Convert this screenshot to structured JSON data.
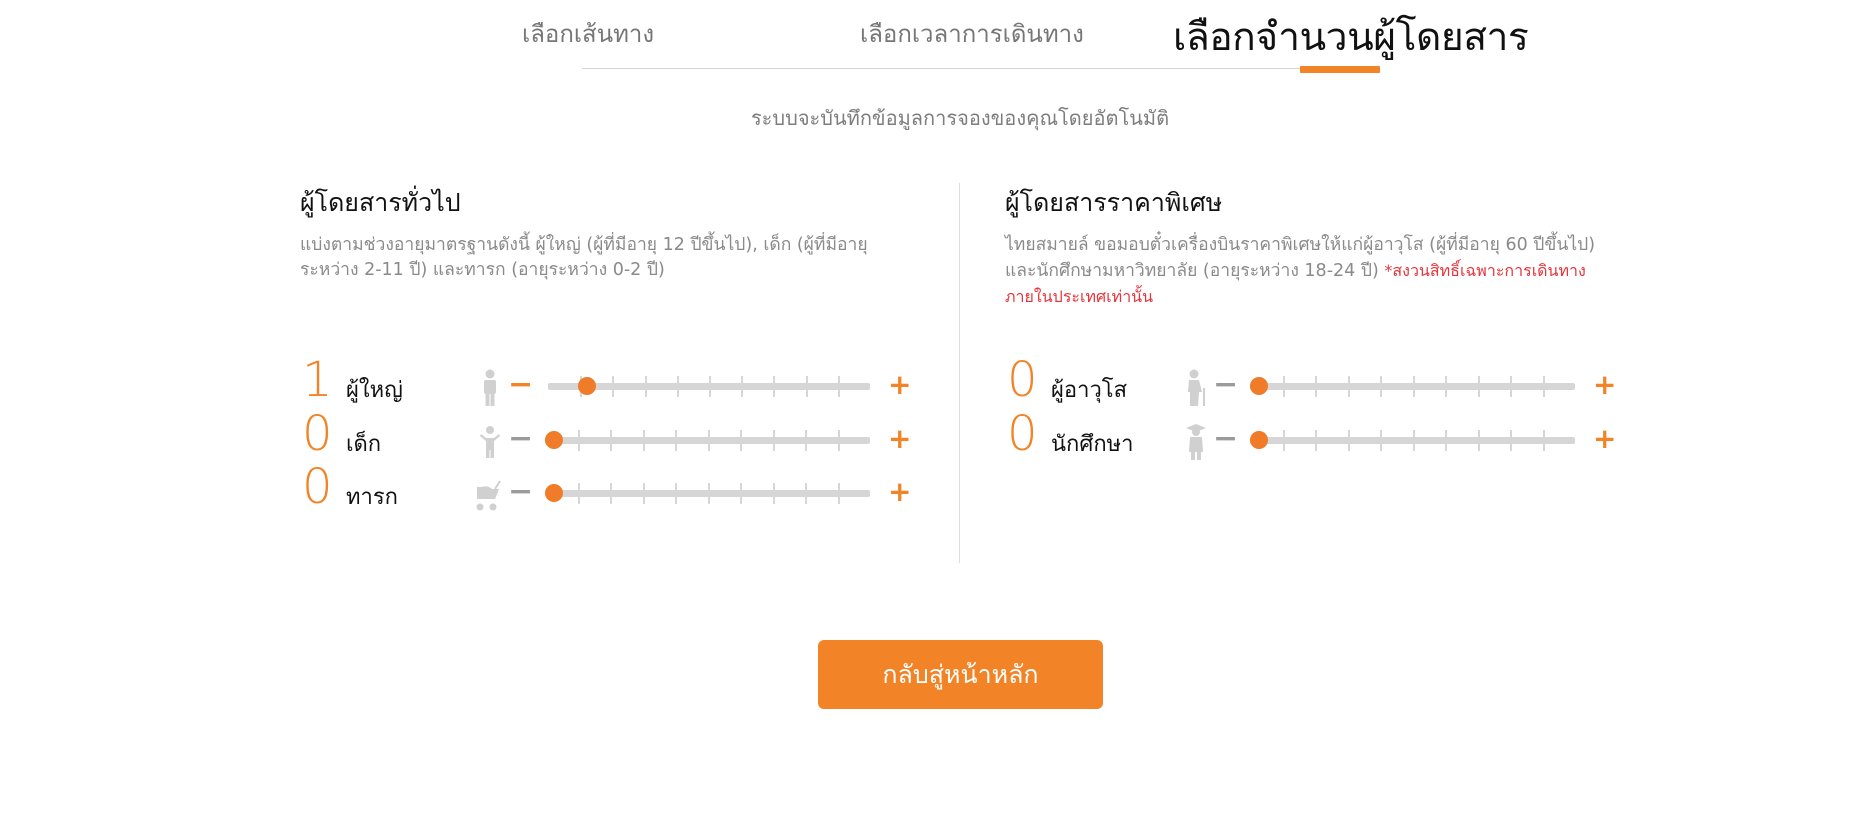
{
  "tabs": {
    "route": "เลือกเส้นทาง",
    "time": "เลือกเวลาการเดินทาง",
    "passengers": "เลือกจำนวนผู้โดยสาร"
  },
  "subtitle": "ระบบจะบันทึกข้อมูลการจองของคุณโดยอัตโนมัติ",
  "general": {
    "title": "ผู้โดยสารทั่วไป",
    "description": "แบ่งตามช่วงอายุมาตรฐานดังนี้ ผู้ใหญ่ (ผู้ที่มีอายุ 12 ปีขึ้นไป), เด็ก (ผู้ที่มีอายุระหว่าง 2-11 ปี) และทารก (อายุระหว่าง 0-2 ปี)",
    "rows": [
      {
        "label": "ผู้ใหญ่",
        "count": "1",
        "minus": "−",
        "plus": "+",
        "icon": "adult-icon",
        "level": 0.1,
        "minus_active": true
      },
      {
        "label": "เด็ก",
        "count": "0",
        "minus": "−",
        "plus": "+",
        "icon": "child-icon",
        "level": 0,
        "minus_active": false
      },
      {
        "label": "ทารก",
        "count": "0",
        "minus": "−",
        "plus": "+",
        "icon": "stroller-icon",
        "level": 0,
        "minus_active": false
      }
    ]
  },
  "special": {
    "title": "ผู้โดยสารราคาพิเศษ",
    "description": "ไทยสมายล์ ขอมอบตั๋วเครื่องบินราคาพิเศษให้แก่ผู้อาวุโส (ผู้ที่มีอายุ 60 ปีขึ้นไป) และนักศึกษามหาวิทยาลัย (อายุระหว่าง 18-24 ปี)",
    "note": "*สงวนสิทธิ์เฉพาะการเดินทางภายในประเทศเท่านั้น",
    "rows": [
      {
        "label": "ผู้อาวุโส",
        "count": "0",
        "minus": "−",
        "plus": "+",
        "icon": "senior-icon",
        "level": 0,
        "minus_active": false
      },
      {
        "label": "นักศึกษา",
        "count": "0",
        "minus": "−",
        "plus": "+",
        "icon": "graduate-icon",
        "level": 0,
        "minus_active": false
      }
    ]
  },
  "home_button": "กลับสู่หน้าหลัก",
  "colors": {
    "accent": "#f28427",
    "muted": "#9b9b9b",
    "track": "#d6d6d6",
    "note": "#e8333a"
  }
}
